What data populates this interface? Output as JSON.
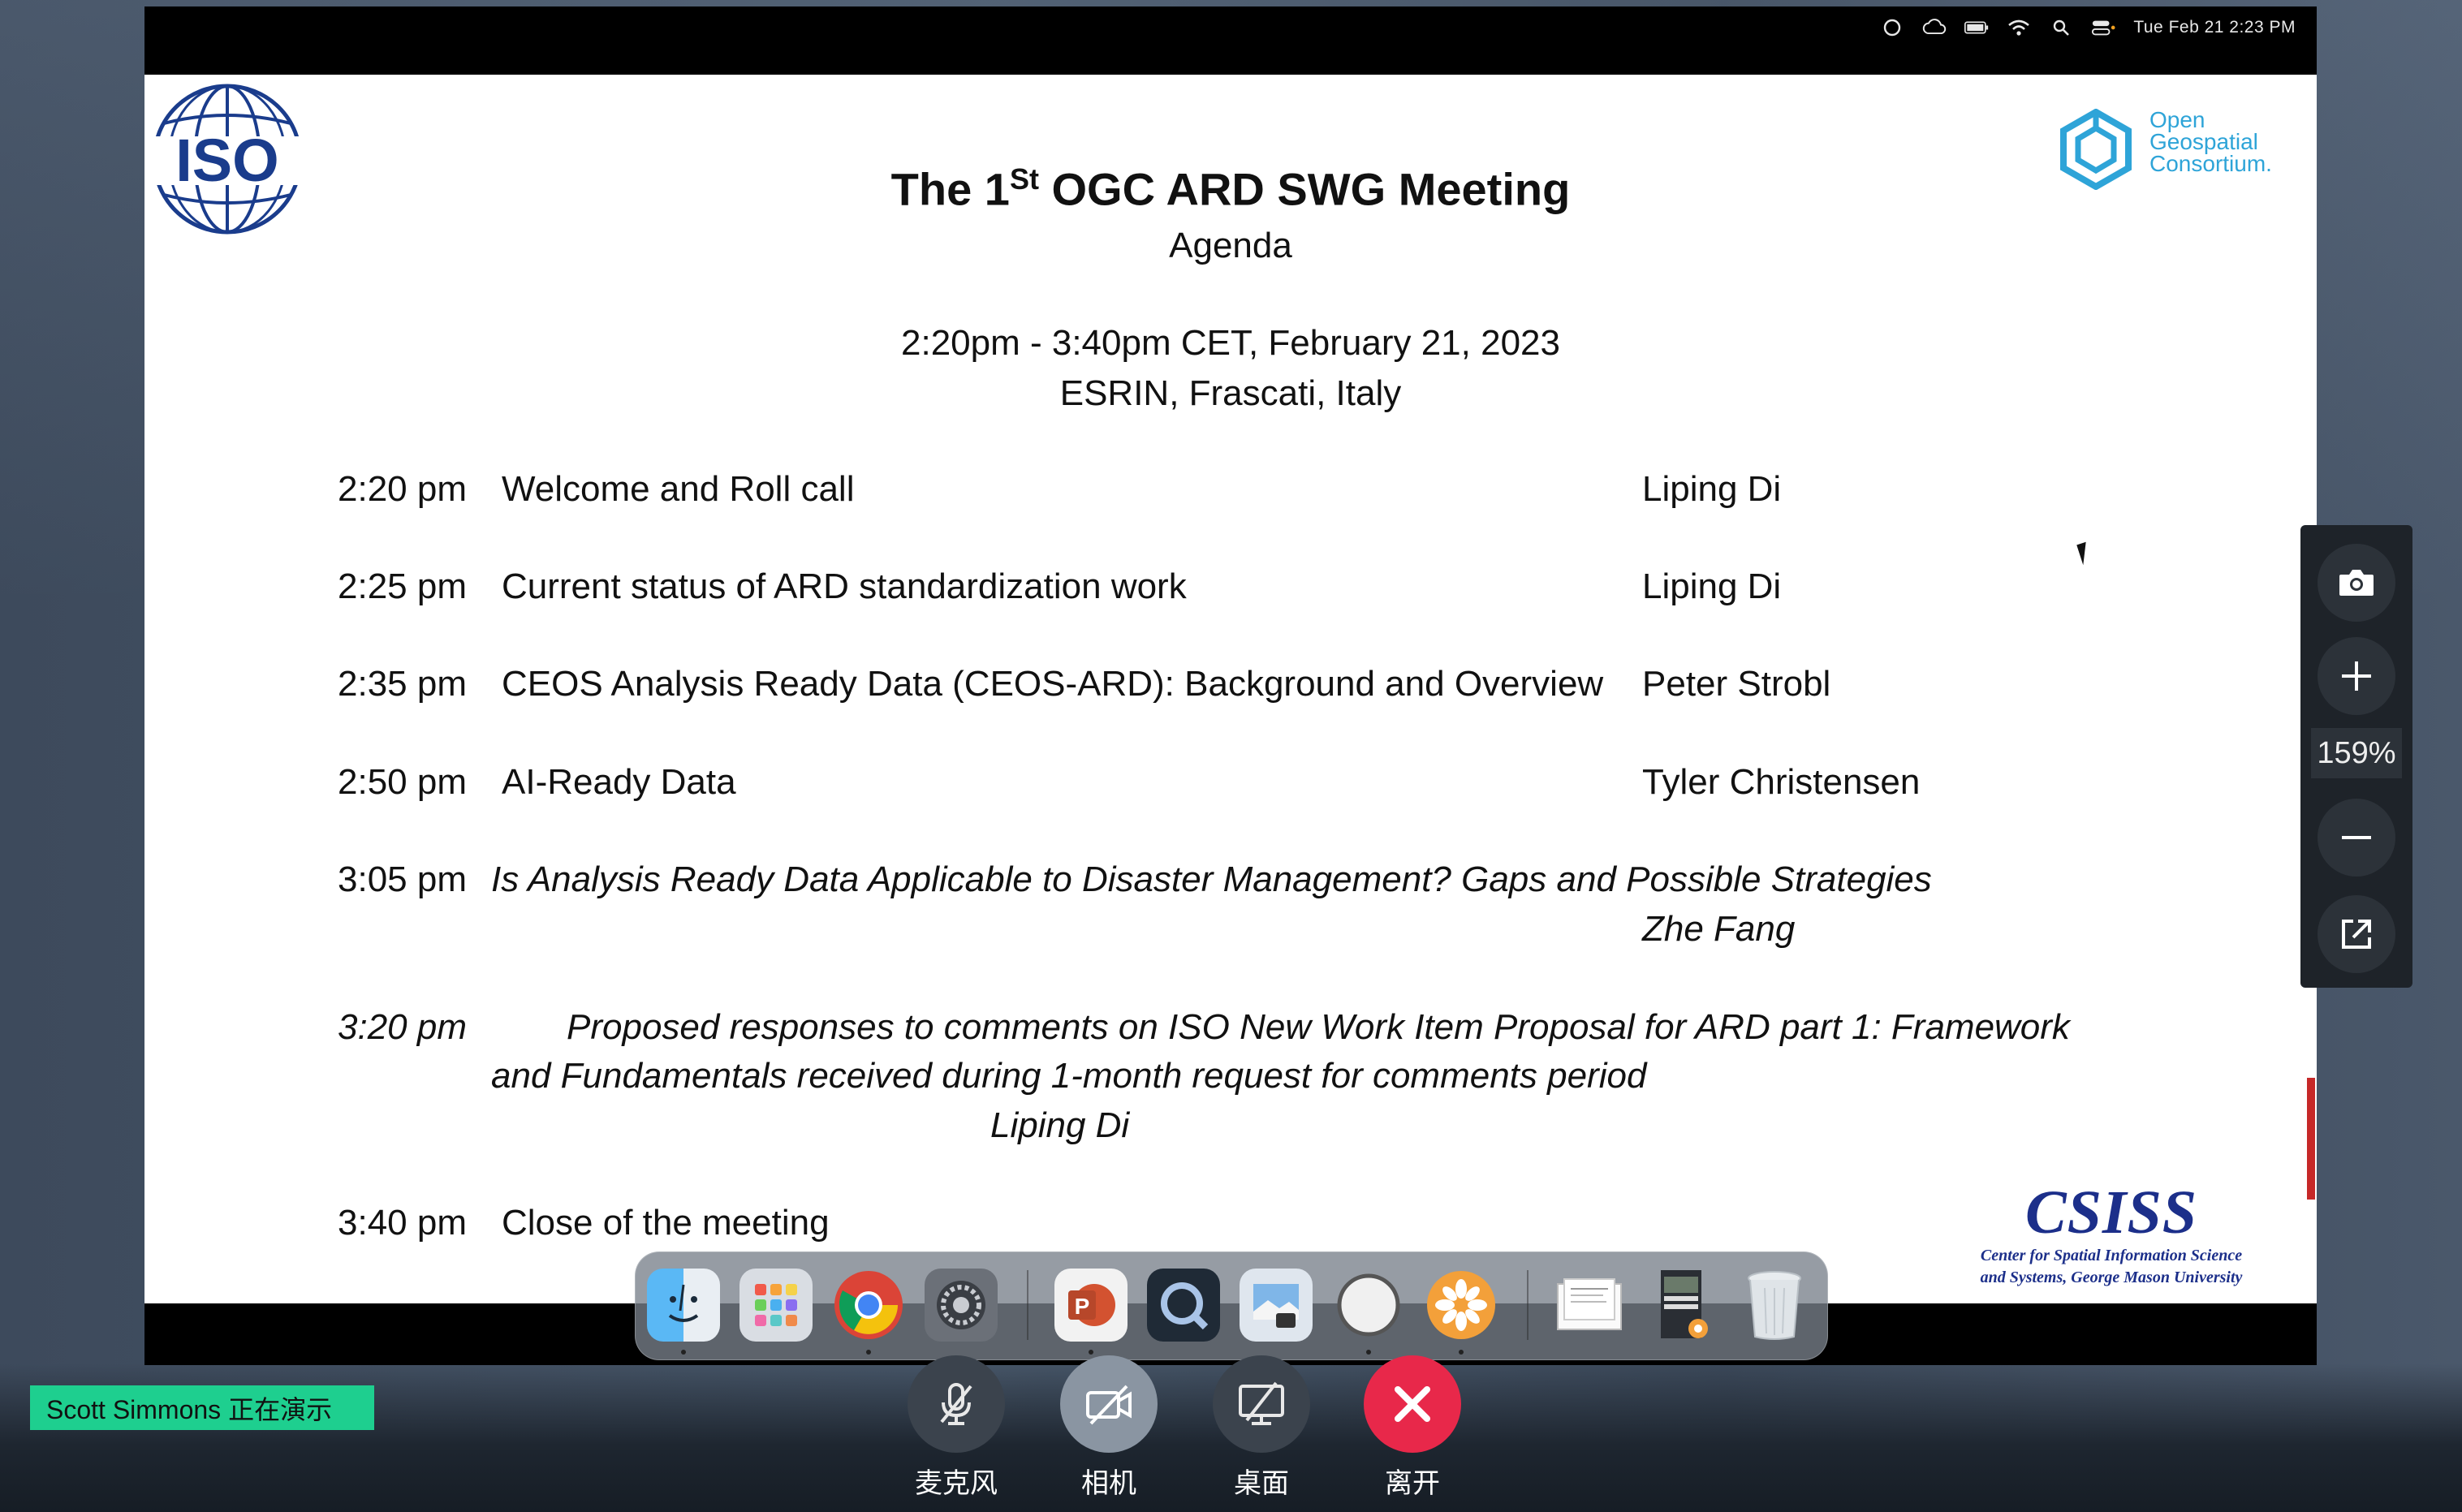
{
  "menubar": {
    "clock": "Tue Feb 21  2:23 PM"
  },
  "slide": {
    "title_main": "The 1",
    "title_sup": "St",
    "title_rest": " OGC ARD SWG Meeting",
    "subtitle": "Agenda",
    "time_range": "2:20pm - 3:40pm CET, February 21, 2023",
    "location": "ESRIN, Frascati, Italy",
    "agenda": [
      {
        "time": "2:20 pm",
        "topic": "Welcome and Roll call",
        "speaker": "Liping Di"
      },
      {
        "time": "2:25 pm",
        "topic": "Current status of ARD standardization work",
        "speaker": "Liping Di"
      },
      {
        "time": "2:35 pm",
        "topic": "CEOS Analysis Ready Data (CEOS-ARD): Background and Overview",
        "speaker": "Peter Strobl"
      },
      {
        "time": "2:50 pm",
        "topic": "AI-Ready Data",
        "speaker": "Tyler Christensen"
      },
      {
        "time": "3:05 pm",
        "topic": "Is Analysis Ready Data Applicable to Disaster Management? Gaps and Possible Strategies",
        "speaker": "Zhe Fang"
      },
      {
        "time": "3:20 pm",
        "topic_line1": "Proposed responses to comments on ISO New Work Item Proposal for ARD part 1: Framework",
        "topic_line2": "and Fundamentals received during 1-month request for comments period",
        "speaker": "Liping Di"
      },
      {
        "time": "3:40 pm",
        "topic": "Close of the meeting"
      }
    ],
    "logos": {
      "iso": "ISO",
      "ogc_line1": "Open",
      "ogc_line2": "Geospatial",
      "ogc_line3": "Consortium.",
      "csiss_title": "CSISS",
      "csiss_line1": "Center for Spatial Information Science",
      "csiss_line2": "and Systems, George Mason University"
    }
  },
  "side_controls": {
    "zoom": "159%",
    "icons": [
      "camera-icon",
      "zoom-in-icon",
      "zoom-out-icon",
      "popout-icon"
    ]
  },
  "dock": {
    "apps": [
      "finder",
      "launchpad",
      "chrome",
      "system-settings",
      "powerpoint",
      "quicktime",
      "preview",
      "circle-app",
      "flower-app",
      "document-thumbnail",
      "screenshot-thumbnail",
      "trash"
    ]
  },
  "meeting": {
    "presenter_label": "Scott  Simmons 正在演示",
    "buttons": [
      {
        "label": "麦克风",
        "icon": "microphone-off-icon"
      },
      {
        "label": "相机",
        "icon": "camera-off-icon"
      },
      {
        "label": "桌面",
        "icon": "screen-share-off-icon"
      },
      {
        "label": "离开",
        "icon": "leave-icon"
      }
    ]
  },
  "colors": {
    "leave": "#e8284a",
    "presenter_badge": "#1ecf8f",
    "ogc_blue": "#2ea4d8",
    "iso_blue": "#1a3c8c",
    "csiss_blue": "#1c2f8a"
  }
}
